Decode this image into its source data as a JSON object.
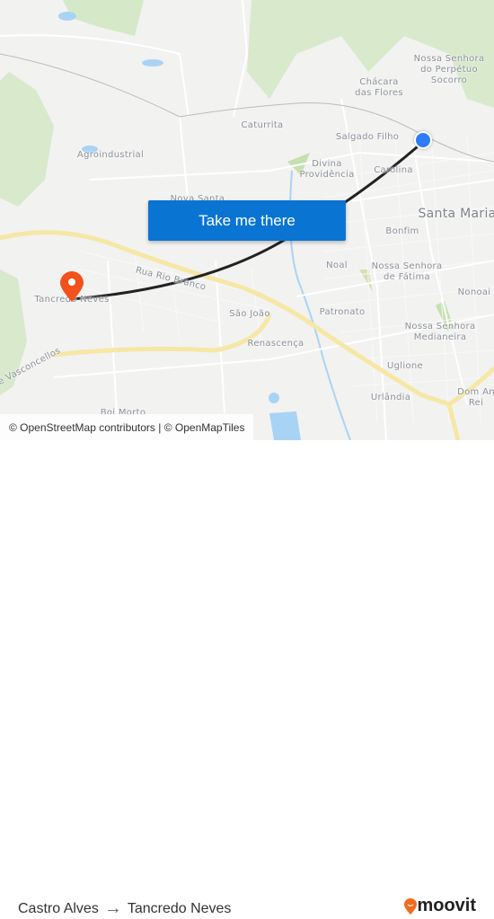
{
  "map": {
    "labels": [
      {
        "id": "nossa-senhora-perpetuo-socorro",
        "text": "Nossa Senhora\ndo Perpétuo\nSocorro"
      },
      {
        "id": "chacara-das-flores",
        "text": "Chácara\ndas Flores"
      },
      {
        "id": "caturrita",
        "text": "Caturrita"
      },
      {
        "id": "salgado-filho",
        "text": "Salgado Filho"
      },
      {
        "id": "agroindustrial",
        "text": "Agroindustrial"
      },
      {
        "id": "divina-providencia",
        "text": "Divina\nProvidência"
      },
      {
        "id": "carolina",
        "text": "Carolina"
      },
      {
        "id": "nova-santa",
        "text": "Nova Santa"
      },
      {
        "id": "santa-maria",
        "text": "Santa Maria"
      },
      {
        "id": "bonfim",
        "text": "Bonfim"
      },
      {
        "id": "noal",
        "text": "Noal"
      },
      {
        "id": "nossa-senhora-de-fatima",
        "text": "Nossa Senhora\nde Fátima"
      },
      {
        "id": "nonoai",
        "text": "Nonoai"
      },
      {
        "id": "rua-rio-branco",
        "text": "Rua Rio Branco"
      },
      {
        "id": "tancredo-neves",
        "text": "Tancredo Neves"
      },
      {
        "id": "sao-joao",
        "text": "São João"
      },
      {
        "id": "patronato",
        "text": "Patronato"
      },
      {
        "id": "nossa-senhora-medianeira",
        "text": "Nossa Senhora\nMedianeira"
      },
      {
        "id": "renascenca",
        "text": "Renascença"
      },
      {
        "id": "vasconcellos",
        "text": "de Vasconcellos"
      },
      {
        "id": "uglione",
        "text": "Uglione"
      },
      {
        "id": "urlandia",
        "text": "Urlândia"
      },
      {
        "id": "dom-antonio-reis",
        "text": "Dom An\nRei"
      },
      {
        "id": "boi-morto",
        "text": "Boi Morto"
      }
    ],
    "origin_marker_color": "#2f7cf6",
    "destination_marker_color": "#f2511b",
    "route_color": "#222222",
    "cta_label": "Take me there",
    "attribution": "© OpenStreetMap contributors | © OpenMapTiles"
  },
  "footer": {
    "origin": "Castro Alves",
    "arrow": "→",
    "destination": "Tancredo Neves",
    "brand": "moovit",
    "brand_color": "#f26b1d"
  }
}
